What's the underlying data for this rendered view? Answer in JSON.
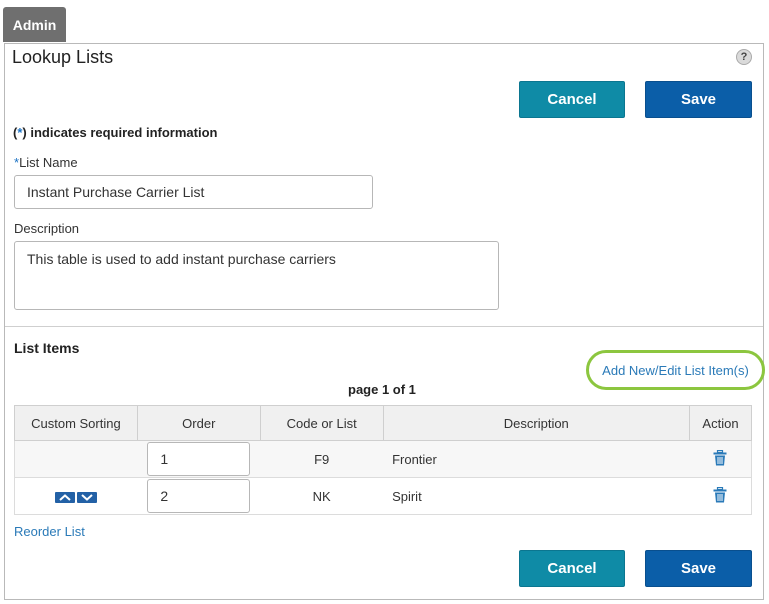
{
  "admin_tab": {
    "label": "Admin"
  },
  "page": {
    "title": "Lookup Lists",
    "help_icon": "?"
  },
  "buttons": {
    "cancel": "Cancel",
    "save": "Save"
  },
  "required_note": {
    "star": "*",
    "open": "(",
    "close": ")",
    "text": " indicates required information"
  },
  "form": {
    "list_name": {
      "star": "*",
      "label": "List Name",
      "value": "Instant Purchase Carrier List"
    },
    "description": {
      "label": "Description",
      "value": "This table is used to add instant purchase carriers"
    }
  },
  "list_items": {
    "title": "List Items",
    "add_link": "Add New/Edit List Item(s)",
    "pager": "page 1 of 1",
    "columns": [
      "Custom Sorting",
      "Order",
      "Code or List",
      "Description",
      "Action"
    ],
    "rows": [
      {
        "order": "1",
        "code": "F9",
        "description": "Frontier",
        "sort_controls": false
      },
      {
        "order": "2",
        "code": "NK",
        "description": "Spirit",
        "sort_controls": true
      }
    ],
    "reorder_link": "Reorder List"
  },
  "icons": {
    "help": "help-icon",
    "trash": "trash-icon",
    "move_up": "chevron-up-icon",
    "move_down": "chevron-down-icon"
  },
  "colors": {
    "cancel": "#0f8ba6",
    "save": "#0b5ea8",
    "link": "#2a7ab8",
    "highlight": "#8cc63f",
    "admin_tab": "#6f6f6f"
  }
}
